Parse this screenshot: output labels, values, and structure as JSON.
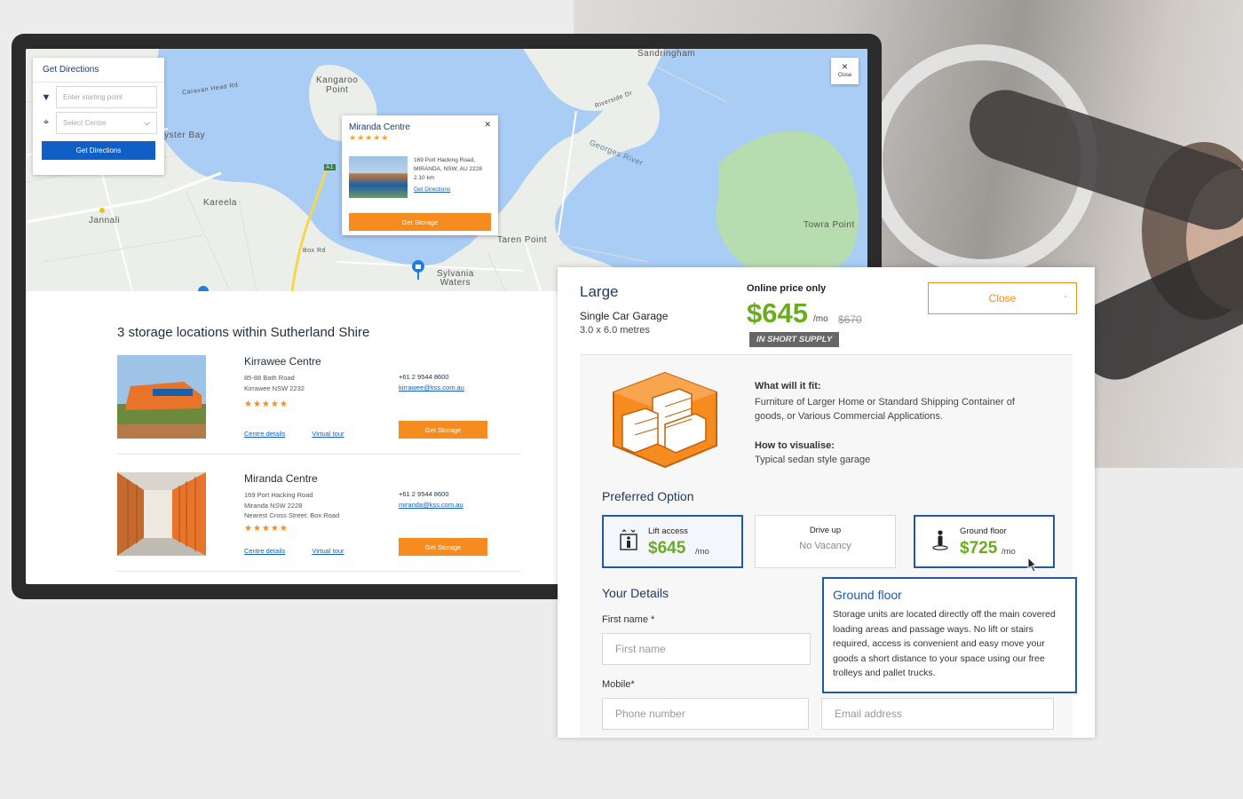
{
  "map": {
    "labels": {
      "sandringham": "Sandringham",
      "kangaroo_point": "Kangaroo\nPoint",
      "oyster_bay": "yster Bay",
      "kareela": "Kareela",
      "jannali": "Jannali",
      "taren_point": "Taren Point",
      "towra_point": "Towra Point",
      "sylvania_waters": "Sylvania\nWaters",
      "georges_river": "Georges River",
      "caravan_head_rd": "Caravan Head Rd",
      "riverside_dr": "Riverside Dr",
      "box_rd": "Box Rd",
      "a1": "A1"
    },
    "close_label": "Close",
    "directions_panel": {
      "title": "Get Directions",
      "start_placeholder": "Enter starting point",
      "centre_select": "Select Centre",
      "button": "Get Directions"
    },
    "popup": {
      "title": "Miranda Centre",
      "stars": "★★★★★",
      "address_line1": "169 Port Hacking Road,",
      "address_line2": "MIRANDA, NSW, AU 2228",
      "distance": "2.10 km",
      "link": "Get Directions",
      "button": "Get Storage"
    }
  },
  "listing": {
    "heading": "3 storage locations within Sutherland Shire",
    "locations": [
      {
        "name": "Kirrawee Centre",
        "address1": "85-88 Bath Road",
        "address2": "Kirrawee NSW 2232",
        "address3": "",
        "stars": "★★★★★",
        "phone": "+61 2 9544 8600",
        "email": "kirrawee@kss.com.au",
        "link1": "Centre details",
        "link2": "Virtual tour",
        "button": "Get Storage"
      },
      {
        "name": "Miranda Centre",
        "address1": "169 Port Hacking Road",
        "address2": "Miranda NSW 2228",
        "address3": "Nearest Cross Street: Box Road",
        "stars": "★★★★★",
        "phone": "+61 2 9544 8600",
        "email": "miranda@kss.com.au",
        "link1": "Centre details",
        "link2": "Virtual tour",
        "button": "Get Storage"
      }
    ]
  },
  "unit": {
    "size": "Large",
    "type": "Single Car Garage",
    "dimensions": "3.0 x 6.0 metres",
    "online_label": "Online price only",
    "price": "$645",
    "per_month": "/mo",
    "old_price": "$670",
    "badge": "IN SHORT SUPPLY",
    "close_button": "Close",
    "close_icon": "-",
    "fit_heading": "What will it fit:",
    "fit_text": "Furniture of Larger Home or Standard Shipping Container of goods, or Various Commercial Applications.",
    "visualise_heading": "How to visualise:",
    "visualise_text": "Typical sedan style garage",
    "preferred_heading": "Preferred Option",
    "options": [
      {
        "label": "Lift access",
        "price": "$645",
        "per_month": "/mo",
        "icon": "lift-icon"
      },
      {
        "label": "Drive up",
        "status": "No Vacancy"
      },
      {
        "label": "Ground floor",
        "price": "$725",
        "per_month": "/mo",
        "icon": "person-ground-icon"
      }
    ],
    "details_heading": "Your Details",
    "fields": {
      "first_name_label": "First name *",
      "first_name_placeholder": "First name",
      "mobile_label": "Mobile*",
      "phone_placeholder": "Phone number",
      "email_placeholder": "Email address"
    },
    "tooltip": {
      "title": "Ground floor",
      "body": "Storage units are located directly off the main covered loading areas and passage ways. No lift or stairs required, access is convenient and easy move your goods a short distance to your space using our free trolleys and pallet trucks."
    }
  },
  "colors": {
    "accent_orange": "#f68b1f",
    "price_green": "#6aac1e",
    "navy": "#1f3a66",
    "link_blue": "#0f5fc6"
  }
}
